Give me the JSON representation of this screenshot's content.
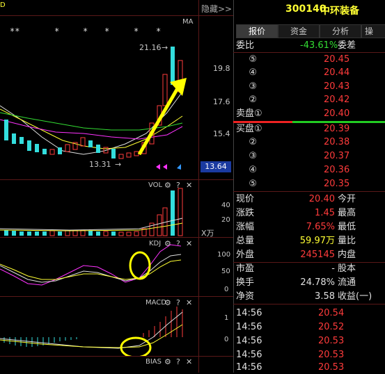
{
  "header": {
    "hide_label": "隐藏>>",
    "code": "300140",
    "name": "中环装备"
  },
  "tabs": [
    {
      "label": "报价",
      "active": true
    },
    {
      "label": "资金",
      "active": false
    },
    {
      "label": "分析",
      "active": false
    },
    {
      "label": "操",
      "active": false
    }
  ],
  "main_chart": {
    "ma_label": "MA",
    "stars": [
      "**",
      "*",
      "*",
      "*",
      "*",
      "*"
    ],
    "high_label": "21.16",
    "low_label": "13.31",
    "price_ticks": [
      "19.8",
      "17.6",
      "15.4"
    ],
    "current_price": "13.64"
  },
  "vol": {
    "label": "VOL",
    "ticks": [
      "40",
      "20"
    ],
    "unit": "X万"
  },
  "kdj": {
    "label": "KDJ",
    "ticks": [
      "100",
      "50",
      "0"
    ]
  },
  "macd": {
    "label": "MACD",
    "ticks": [
      "1",
      "0"
    ]
  },
  "bias": {
    "label": "BIAS"
  },
  "order_book": {
    "webi_label": "委比",
    "webi_value": "-43.61%",
    "weicha_label": "委差",
    "sell": [
      {
        "label": "⑤",
        "price": "20.45"
      },
      {
        "label": "④",
        "price": "20.44"
      },
      {
        "label": "③",
        "price": "20.43"
      },
      {
        "label": "②",
        "price": "20.42"
      },
      {
        "label": "卖盘①",
        "price": "20.40"
      }
    ],
    "buy": [
      {
        "label": "买盘①",
        "price": "20.39"
      },
      {
        "label": "②",
        "price": "20.38"
      },
      {
        "label": "③",
        "price": "20.37"
      },
      {
        "label": "④",
        "price": "20.36"
      },
      {
        "label": "⑤",
        "price": "20.35"
      }
    ]
  },
  "stats": [
    {
      "label": "现价",
      "value": "20.40",
      "label2": "今开",
      "color": "red"
    },
    {
      "label": "涨跌",
      "value": "1.45",
      "label2": "最高",
      "color": "red"
    },
    {
      "label": "涨幅",
      "value": "7.65%",
      "label2": "最低",
      "color": "red"
    },
    {
      "label": "总量",
      "value": "59.97万",
      "label2": "量比",
      "color": "yellow"
    },
    {
      "label": "外盘",
      "value": "245145",
      "label2": "内盘",
      "color": "red"
    }
  ],
  "stats2": [
    {
      "label": "市盈",
      "value": "-",
      "label2": "股本"
    },
    {
      "label": "换手",
      "value": "24.78%",
      "label2": "流通"
    },
    {
      "label": "净资",
      "value": "3.58",
      "label2": "收益(一)"
    }
  ],
  "ticks_list": [
    {
      "time": "14:56",
      "price": "20.54"
    },
    {
      "time": "14:56",
      "price": "20.52"
    },
    {
      "time": "14:56",
      "price": "20.53"
    },
    {
      "time": "14:56",
      "price": "20.53"
    },
    {
      "time": "14:56",
      "price": "20.53"
    }
  ]
}
